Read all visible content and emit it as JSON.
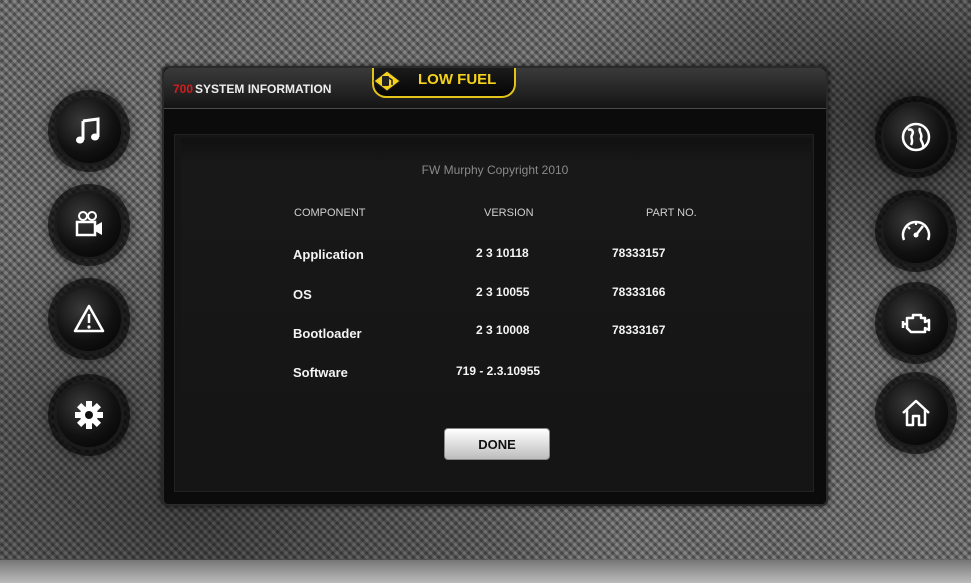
{
  "header": {
    "model_number": "700",
    "title": "SYSTEM INFORMATION",
    "alarm": {
      "text": "LOW FUEL",
      "icon": "fuel-warning-icon",
      "color": "#f5d21b"
    }
  },
  "left_buttons": [
    {
      "icon": "music-icon"
    },
    {
      "icon": "video-camera-icon"
    },
    {
      "icon": "warning-icon"
    },
    {
      "icon": "gear-icon"
    }
  ],
  "right_buttons": [
    {
      "icon": "globe-icon"
    },
    {
      "icon": "gauge-icon"
    },
    {
      "icon": "engine-icon"
    },
    {
      "icon": "home-icon"
    }
  ],
  "info": {
    "copyright": "FW Murphy Copyright 2010",
    "columns": {
      "component": "COMPONENT",
      "version": "VERSION",
      "part_no": "PART NO."
    },
    "rows": [
      {
        "component": "Application",
        "version": "2 3 10118",
        "part_no": "78333157"
      },
      {
        "component": "OS",
        "version": "2 3 10055",
        "part_no": "78333166"
      },
      {
        "component": "Bootloader",
        "version": "2 3 10008",
        "part_no": "78333167"
      },
      {
        "component": "Software",
        "version": "719 - 2.3.10955",
        "part_no": ""
      }
    ]
  },
  "done_label": "DONE",
  "colors": {
    "accent_red": "#d21e1e",
    "alarm_yellow": "#f5d21b"
  }
}
